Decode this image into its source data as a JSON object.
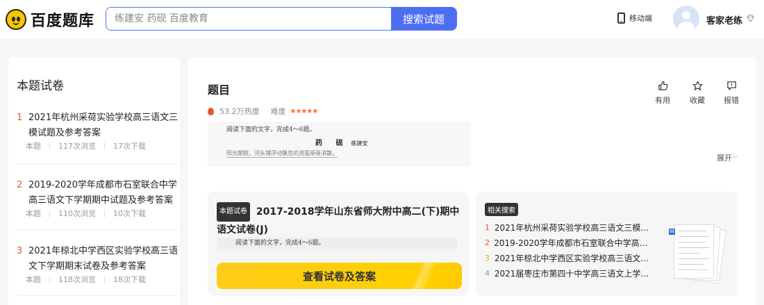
{
  "header": {
    "logo_text": "百度题库",
    "search_placeholder": "练建安 药砚 百度教育",
    "search_button": "搜索试题",
    "mobile_label": "移动端",
    "username": "客家老练"
  },
  "sidebar": {
    "title": "本题试卷",
    "items": [
      {
        "num": "1",
        "title": "2021年杭州采荷实验学校高三语文三模试题及参考答案",
        "tag": "本题",
        "views": "117次浏览",
        "downloads": "17次下载"
      },
      {
        "num": "2",
        "title": "2019-2020学年成都市石室联合中学高三语文下学期期中试题及参考答案",
        "tag": "本题",
        "views": "110次浏览",
        "downloads": "10次下载"
      },
      {
        "num": "3",
        "title": "2021年椋北中学西区实验学校高三语文下学期期末试卷及参考答案",
        "tag": "本题",
        "views": "118次浏览",
        "downloads": "18次下载"
      }
    ]
  },
  "main": {
    "title": "题目",
    "heat": "53.2万热度",
    "difficulty_label": "难度",
    "stars": "★★★★★",
    "actions": [
      {
        "label": "有用",
        "icon": "thumbs-up-icon",
        "glyph": "👍"
      },
      {
        "label": "收藏",
        "icon": "star-icon",
        "glyph": "☆"
      },
      {
        "label": "报错",
        "icon": "report-icon",
        "glyph": "⚠"
      }
    ],
    "preview": {
      "line1": "阅读下面的文字，完成4～6题。",
      "heading": "药 砚",
      "author": "练建安",
      "line3": "阳光朗照，河头铺浮动飘忽的流萤渐渐消散。"
    },
    "expand": "展开",
    "card": {
      "tag": "本题试卷",
      "title": "2017-2018学年山东省师大附中高二(下)期中语文试卷(J)",
      "snippet": "阅读下面的文字，完成4～6题。",
      "button": "查看试卷及答案"
    },
    "related": {
      "tag": "相关搜索",
      "items": [
        {
          "num": "1",
          "title": "2021年杭州采荷实验学校高三语文三模试..."
        },
        {
          "num": "2",
          "title": "2019-2020学年成都市石室联合中学高三语..."
        },
        {
          "num": "3",
          "title": "2021年椋北中学西区实验学校高三语文下..."
        },
        {
          "num": "4",
          "title": "2021届枣庄市第四十中学高三语文上学期..."
        }
      ]
    }
  }
}
